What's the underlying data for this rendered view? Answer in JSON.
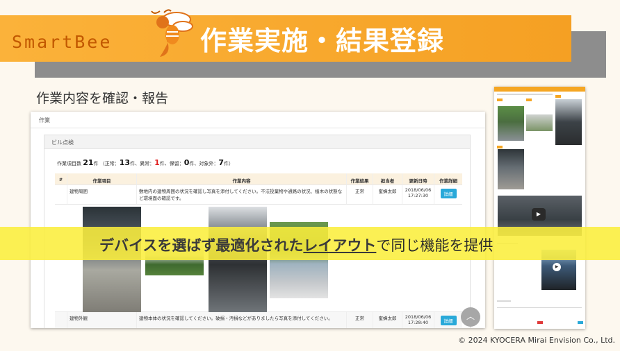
{
  "header": {
    "logo": "SmartBee",
    "title": "作業実施・結果登録"
  },
  "subtitle": "作業内容を確認・報告",
  "desktop": {
    "section": "作業",
    "card_title": "ビル点検",
    "summary": {
      "total_label": "作業項目数",
      "total": "21",
      "unit": "件",
      "normal_label": "（正常：",
      "normal": "13",
      "abnormal_label": "件、異常：",
      "abnormal": "1",
      "hold_label": "件、保留：",
      "hold": "0",
      "excluded_label": "件、対象外：",
      "excluded": "7",
      "end": "件）"
    },
    "columns": [
      "#",
      "作業項目",
      "作業内容",
      "作業結果",
      "担当者",
      "更新日時",
      "作業詳細"
    ],
    "rows": [
      {
        "item": "建物周囲",
        "content": "敷地内の建物周囲の状況を確認し写真を添付してください。不法投棄物や通路の状況、植木の状態など環境面の確認です。",
        "result": "正常",
        "person": "蜜蜂太郎",
        "date": "2018/06/06",
        "time": "17:27:30",
        "detail": "詳細"
      },
      {
        "item": "建物外観",
        "content": "建物本体の状況を確認してください。破損・汚損などがありましたら写真を添付してください。",
        "result": "正常",
        "person": "蜜蜂太郎",
        "date": "2018/06/06",
        "time": "17:28:40",
        "detail": "詳細"
      }
    ]
  },
  "banner": {
    "part1": "デバイスを選ばず最適化された",
    "part2": "レイアウト",
    "part3": "で同じ機能を提供"
  },
  "copyright": "© 2024 KYOCERA Mirai Envision Co., Ltd.",
  "colors": {
    "accent": "#f5a623",
    "detail_button": "#29a9d9",
    "banner": "#faee3c",
    "abnormal": "#e02020"
  }
}
